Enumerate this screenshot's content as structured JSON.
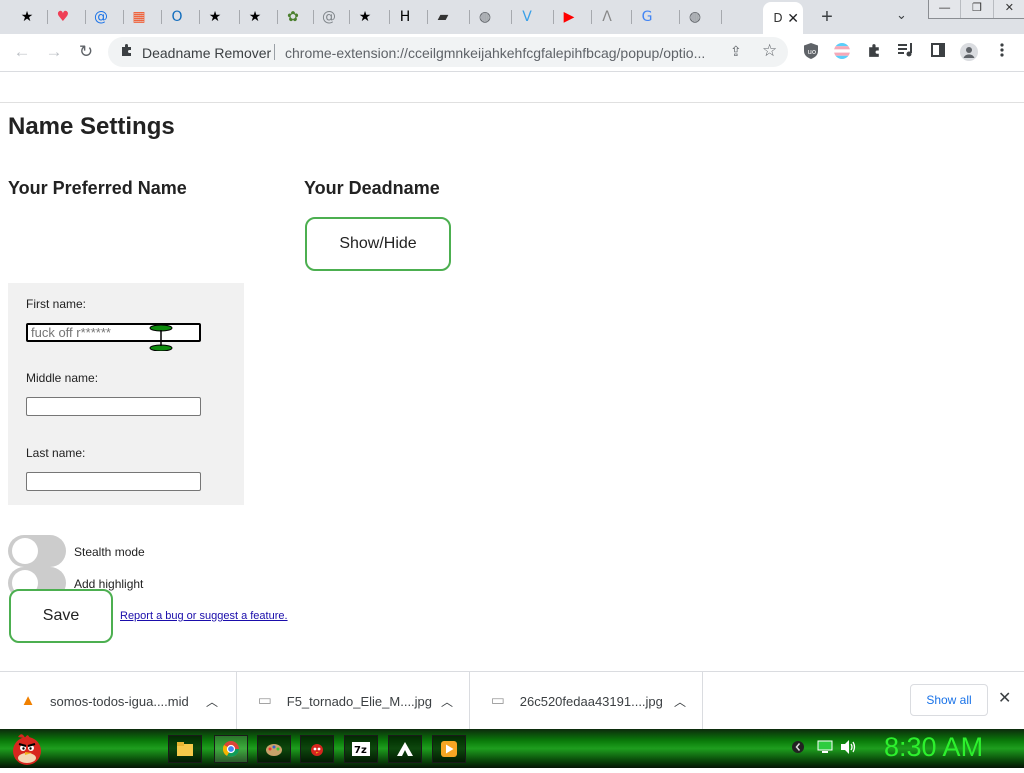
{
  "tabs": [
    {
      "icon": "star-icon",
      "glyph": "★",
      "color": "#000"
    },
    {
      "icon": "pocket-heart-icon",
      "glyph": "♥",
      "color": "#ef3f56"
    },
    {
      "icon": "at-sign-icon",
      "glyph": "@",
      "color": "#1a73e8"
    },
    {
      "icon": "microsoft-icon",
      "glyph": "▦",
      "color": "#f25022"
    },
    {
      "icon": "outlook-icon",
      "glyph": "O",
      "color": "#0f6cbd"
    },
    {
      "icon": "star-icon",
      "glyph": "★",
      "color": "#000"
    },
    {
      "icon": "star-icon",
      "glyph": "★",
      "color": "#000"
    },
    {
      "icon": "frog-icon",
      "glyph": "✿",
      "color": "#4b7f2e"
    },
    {
      "icon": "at-sign-icon",
      "glyph": "@",
      "color": "#80868b"
    },
    {
      "icon": "star-icon",
      "glyph": "★",
      "color": "#000"
    },
    {
      "icon": "h-letter-icon",
      "glyph": "H",
      "color": "#000"
    },
    {
      "icon": "clapperboard-icon",
      "glyph": "▰",
      "color": "#333"
    },
    {
      "icon": "globe-icon",
      "glyph": "◍",
      "color": "#5f6368"
    },
    {
      "icon": "v-letter-icon",
      "glyph": "V",
      "color": "#3aa0e8"
    },
    {
      "icon": "youtube-icon",
      "glyph": "▶",
      "color": "#ff0000"
    },
    {
      "icon": "lambda-icon",
      "glyph": "Λ",
      "color": "#888"
    },
    {
      "icon": "google-icon",
      "glyph": "G",
      "color": "#4285f4"
    },
    {
      "icon": "globe-icon",
      "glyph": "◍",
      "color": "#5f6368"
    }
  ],
  "active_tab": {
    "glyph": "D",
    "close": "✕"
  },
  "tabstrip": {
    "new_tab": "+",
    "menu": "⌄"
  },
  "window": {
    "minimize": "—",
    "restore": "❐",
    "close": "✕"
  },
  "nav": {
    "back": "←",
    "forward": "→",
    "reload": "↻"
  },
  "omnibox": {
    "site_name": "Deadname Remover",
    "url": "chrome-extension://cceilgmnkeijahkehfcgfalepihfbcag/popup/optio...",
    "share": "⇪",
    "star": "☆"
  },
  "toolbar_icons": [
    "ublock-icon",
    "trans-flag-icon",
    "puzzle-icon",
    "media-icon",
    "sidepanel-icon",
    "profile-icon",
    "kebab-menu-icon"
  ],
  "page": {
    "title": "Name Settings",
    "preferred_heading": "Your Preferred Name",
    "deadname_heading": "Your Deadname",
    "show_hide": "Show/Hide",
    "first_label": "First name:",
    "first_placeholder": "fuck off r******",
    "middle_label": "Middle name:",
    "last_label": "Last name:",
    "stealth_label": "Stealth mode",
    "highlight_label": "Add highlight",
    "stealth_on": false,
    "highlight_on": false,
    "save": "Save",
    "report_link": "Report a bug or suggest a feature."
  },
  "downloads": {
    "items": [
      {
        "name": "somos-todos-igua....mid",
        "icon": "vlc-cone-icon",
        "glyph": "▲",
        "color": "#f08000"
      },
      {
        "name": "F5_tornado_Elie_M....jpg",
        "icon": "image-file-icon",
        "glyph": "▭",
        "color": "#999"
      },
      {
        "name": "26c520fedaa43191....jpg",
        "icon": "image-file-icon",
        "glyph": "▭",
        "color": "#999"
      }
    ],
    "show_all": "Show all",
    "close": "✕"
  },
  "taskbar": {
    "clock": "8:30 AM",
    "apps": [
      "file-explorer-icon",
      "chrome-icon",
      "paint-icon",
      "angry-birds-icon",
      "7zip-icon",
      "arch-icon",
      "media-player-icon"
    ]
  }
}
